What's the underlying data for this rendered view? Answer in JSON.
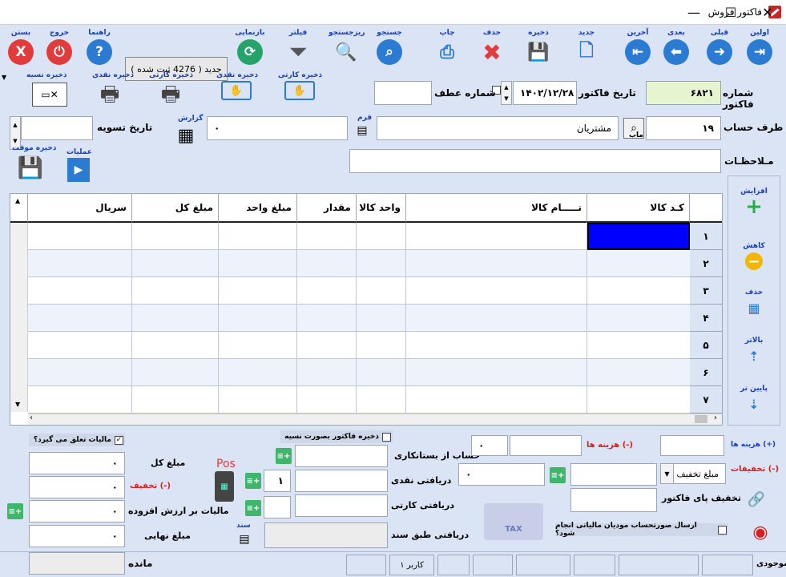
{
  "window": {
    "title": "فاکتور فروش",
    "minimize": "—",
    "maximize": "☐",
    "close": "✕"
  },
  "toolbar": {
    "first": "اولین",
    "prev": "قبلی",
    "next": "بعدی",
    "last": "آخرین",
    "new": "جدید",
    "save": "ذخیره",
    "delete": "حذف",
    "print": "چاپ",
    "search": "جستجو",
    "subsearch": "ریزجستجو",
    "filter": "فیلتر",
    "refresh": "بازنمایی",
    "help": "راهنما",
    "exit": "خروج",
    "close": "بستن",
    "status": "جدید ( 4276 ثبت شده )"
  },
  "header": {
    "invoice_number_label": "شماره فاکتور",
    "invoice_number": "۶۸۲۱",
    "invoice_date_label": "تاریخ  فاکتور",
    "invoice_date": "۱۴۰۲/۱۲/۲۸",
    "ref_number_label": "شماره عطف",
    "account_label": "طرف حساب",
    "account_code": "۱۹",
    "account_name": "مشتریان",
    "settlement_date_label": "تاریخ تسویه",
    "account_amount": "۰",
    "notes_label": "مـلاحظـات",
    "account_search_label": "ماب",
    "ghr_label": "قرم",
    "report_label": "گزارش",
    "operations_label": "عملیات",
    "temp_save_label": "ذخیره موقت"
  },
  "quick_buttons": {
    "card_save_1": "ذخیره کارتی",
    "cash_save_1": "ذخیره نقدی",
    "card_save_2": "ذخیره کارتی",
    "cash_save_2": "ذخیره نقدی",
    "credit_save": "ذخیره نسیه"
  },
  "grid": {
    "columns": [
      "کـد کالا",
      "نـــــام کالا",
      "واحد کالا",
      "مقدار",
      "مبلغ واحد",
      "مبلغ کل",
      "سریال"
    ],
    "rows": [
      "۱",
      "۲",
      "۳",
      "۴",
      "۵",
      "۶",
      "۷"
    ]
  },
  "side_panel": {
    "increase": "افزایش",
    "decrease": "کاهش",
    "delete": "حذف",
    "up": "بالاتر",
    "down": "پایین تر"
  },
  "totals": {
    "tax_applicable_label": "مالیات تعلق می گیرد؟",
    "total_amount_label": "مبلغ کل",
    "total_amount": "۰",
    "discount_label": "تخفیف (-)",
    "discount": "۰",
    "vat_label": "مالیات بر ارزش افزوده",
    "vat": "۰",
    "final_amount_label": "مبلغ نهایی",
    "final_amount": "۰",
    "remaining_label": "مانده",
    "pos_label": "Pos"
  },
  "payments": {
    "credit_invoice_label": "ذخیره فاکتور بصورت نسیه",
    "creditor_account_label": "حساب از بستانکاری",
    "cash_received_label": "دریافتی نقدی",
    "cash_count": "۱",
    "card_received_label": "دریافتی کارتی",
    "doc_received_label": "دریافتی طبق سند",
    "doc_label": "سند"
  },
  "costs": {
    "costs_plus_label": "هزینه ها (+)",
    "costs_minus_label": "هزینه ها (-)",
    "costs_minus_value": "۰",
    "discounts_label": "تخفیفات (-)",
    "discount_type": "مبلغ تخفیف",
    "discount_value": "۰",
    "invoice_footer_discount_label": "تخفیف پای فاکتور",
    "taxpayer_label": "ارسال صورتحساب مودیان مالیاتی انجام شود؟",
    "tax_logo": "TAX"
  },
  "statusbar": {
    "stock_label": "موجودی",
    "user_label": "کاربر ۱"
  }
}
